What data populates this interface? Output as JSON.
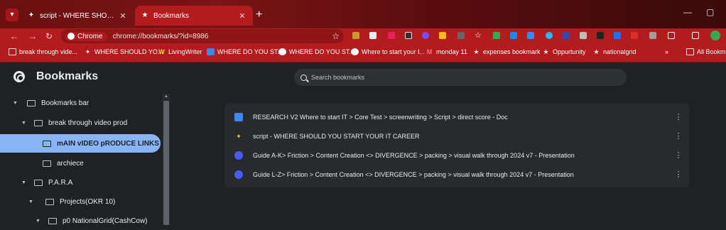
{
  "tabs": [
    {
      "title": "script - WHERE SHOULD YOU S",
      "icon": "wand-icon"
    },
    {
      "title": "Bookmarks",
      "icon": "star-icon"
    }
  ],
  "toolbar": {
    "chip_label": "Chrome",
    "url": "chrome://bookmarks/?id=8986"
  },
  "bookmarks_bar": [
    {
      "label": "break through vide...",
      "icon": "folder-icon"
    },
    {
      "label": "WHERE SHOULD YO...",
      "icon": "wand-icon"
    },
    {
      "label": "LivingWriter",
      "icon": "w-icon"
    },
    {
      "label": "WHERE DO YOU ST...",
      "icon": "doc-icon"
    },
    {
      "label": "WHERE DO YOU ST...",
      "icon": "globe-icon"
    },
    {
      "label": "Where to start your I...",
      "icon": "globe-icon"
    },
    {
      "label": "monday 11",
      "icon": "m-icon"
    },
    {
      "label": "expenses bookmark",
      "icon": "star-icon"
    },
    {
      "label": "Oppurtunity",
      "icon": "star-icon"
    },
    {
      "label": "nationalgrid",
      "icon": "star-icon"
    }
  ],
  "all_bookmarks": "All Bookm",
  "app": {
    "title": "Bookmarks",
    "search_placeholder": "Search bookmarks"
  },
  "tree": [
    {
      "label": "Bookmarks bar",
      "indent": 0
    },
    {
      "label": "break through video prod",
      "indent": 1
    },
    {
      "label": "mAIN vIDEO pRODUCE LINKS",
      "indent": 2,
      "selected": true
    },
    {
      "label": "archiece",
      "indent": 2
    },
    {
      "label": "P.A.R.A",
      "indent": 1
    },
    {
      "label": "Projects(OKR 10)",
      "indent": 2
    },
    {
      "label": "p0 NationalGrid(CashCow)",
      "indent": 3
    }
  ],
  "items": [
    {
      "title": "RESEARCH V2 Where to start IT > Core Test > screenwriting > Script > direct score - Doc",
      "icon": "doc-icon"
    },
    {
      "title": "script - WHERE SHOULD YOU START YOUR IT CAREER",
      "icon": "wand-icon"
    },
    {
      "title": "Guide A-K> Friction > Content Creation <> DIVERGENCE > packing > visual walk through 2024 v7 - Presentation",
      "icon": "slides-icon"
    },
    {
      "title": "Guide L-Z> Friction > Content Creation <> DIVERGENCE > packing > visual walk through 2024 v7 - Presentation",
      "icon": "slides-icon"
    }
  ],
  "colors": {
    "accent": "#b31b1e",
    "selected": "#8ab4f8",
    "background": "#202124",
    "card": "#292a2d"
  }
}
